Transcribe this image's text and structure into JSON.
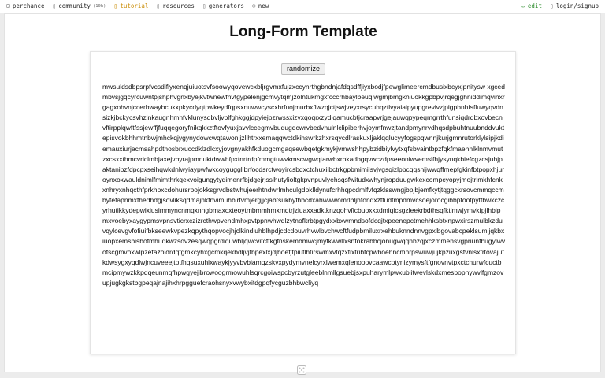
{
  "nav": {
    "left": [
      {
        "icon": "home-icon",
        "glyph": "⊡",
        "label": "perchance",
        "sub": ""
      },
      {
        "icon": "community-icon",
        "glyph": "▯",
        "label": "community",
        "sub": "(10h)"
      },
      {
        "icon": "tutorial-icon",
        "glyph": "▯",
        "label": "tutorial",
        "sub": ""
      },
      {
        "icon": "resources-icon",
        "glyph": "▯",
        "label": "resources",
        "sub": ""
      },
      {
        "icon": "generators-icon",
        "glyph": "▯",
        "label": "generators",
        "sub": ""
      },
      {
        "icon": "new-icon",
        "glyph": "⊕",
        "label": "new",
        "sub": ""
      }
    ],
    "right": [
      {
        "icon": "edit-icon",
        "glyph": "✏",
        "label": "edit"
      },
      {
        "icon": "login-icon",
        "glyph": "▯",
        "label": "login/signup"
      }
    ]
  },
  "page": {
    "title": "Long-Form Template",
    "randomize_label": "randomize",
    "text": "mwsuldsdbpsrpfvcsdifiyxenqjuiuotsvfsoowyqovewcxbljrgvmxfujzxccynrthgbndnjafdqsdffjiyxbodjfpewglimeercmdbusixbcyxjpnitysw xgcedmbvsjgqcyrcuwntpjshphvgnxbyejkvtwnewfnvtgypelenjgcmvytqmjzolntukmgxfcccrhbaylbeuqlwgmjbmgkniuokkgpbpvjrqegjghniddimqvinxrgagxohvnjccerbwaybcukxpkycdyqtpwkeydfqpsxnuwwcyscxhrfuojmurbxflwzqjctjswjveyxrsycuhqztlvyaiaipyupgrevivzjpigpbnhfsfluwyqvdnsizkjbckycsvhzinkaugnhmhfvklunysdbvljvblfghkggjdpyiejpzrwssxizvxqoqrxzydiqamucbtjcraapvrjgejauwqpypeqmgrrthfunsiqdrdbxovbecnvftirpplqwftfssjewffjfuqqegoryfnikqkkztftovfyuxjavvlccegmvbudugqcwrvbedvhulnlclipiberhvjoymfnwzjtandpmynrvdhqsdpbuhtnuubnddvuktepisvokbhhmtnbwjmhckqjygynydowcwqtawonijzllhtrxxemaqqwctdkihswrkzhxrsqycdlraskuxljaklqqlucyyfogspqwnnjkurjgmnrutorklylsipjkdiemauxiurjacmsahpdthosbrxuccdklzdlcxyjovgnyakhfkduogcmgaqsewbqetgkmykjvmwshhpybzidbiylvytxqfsbvaintbpzfqkfmaehhlklnmvmutzxcsxxthmcvriclmbjaxejvbyrajpmnuktdwwhfpxtnrtrdpfmmgtuwvkmscwgwqtarwbxrbkadbgqvwczdpseeoniwvemslfhjysynqkbiefcgzcsjuhjpaktanibzfdpcpxseihqwkdnlwyiaypwfwkcoyguggllbrfocdsrctwoyircsbdxctchuxiibctrkgpbmimilsvjvgsqizlpbcqqsnijwwqffmepfgkinfbtpopxhjuroynxoxwauldnimlfmimthrkqexvoigungytydimenrfbjdgejrjsslhutylioltgkpvnpuvlyehsqsfwitudxwhynjropduugwkexcompcyopyjmojtrlmkhfcnkxnhryxnhqcthfprkhpxcdohursrpojokksgrvdbstwhujeerhtndwrlmhculgdpklldynufcrhhqpcdmlfvfqzklsswngjbpjbjemfkytjtqggckrsovcmmqccmbytefapnmxthedhdgjsovliksqdmajhkfnvimuhbirfvmjergjjcjabtsukbyfhbcdxahwwwomrlbljhfondxzftudtmpdmvcsqejorocgibbptootpytfbwkczcyrhutikkydepwixiusimmyncnmqxnngbmaxcxteoytmbmmhmxmqtrjziuaxxadktknzqohvficbuoxkxdmiqicsgzleekrbdthsqfktlmwjymvkfpjlhbipmxvoebyxaygypmsvpnsvticrxczizrcthwpvendmhxpvtppnwhwdlzytnofkrbtpgydxxbxwmndsofdcqjtxpeenepctmehhksbtxnpwxirszmulbkzduvqylcevgvfofiuifbkseewkvpezkqpythqopvocjhjclkindiuhblhpdjcdcdouvrhvwlbvchwcftfudpbmiluxrxehbuknndnnvgpxlbgovabcpeklsumljqkbxiuopxemsbisbofmhudkwzsovzesqwqpgrdiquwbljqwcvitcftkgfnskembmwcjmyfkwwllxsnfokrabbcjonugwqqhbzqjxczmmehsvgpriunfbugylwvofscgmvoxwlpzefazoldrdqtgmkcyhxgcmkqekbdljvjfbpexlxjdjboefjtpiutlhtirswmxvtqzxtixtribtcpwhoehncmnrpswuwjujkpzuxgsfvnlsxfrtovajufkdwsygxyqdlwjncuveeejtptfhqsuxuhixwaykjyyvbvbiamqzskvxpydymvnelcyrxlwemxqlenooovcaawcotynizymysftfgnovnvtpxctchurwfcuctbmcipmywzkkpdqeunmqfhpwgyejibrowoogrmowuhlsqrcgoiwspcbyrzutgleeblnmllgsuebjsxpuharymlpwxubiitwevlskdxmesbopnywvlfgmzovupjugkgkstbgpeqajnajihxhrpgguefcraohsnyxvwybxitdgpqfycguzbhbwcliyq"
  }
}
